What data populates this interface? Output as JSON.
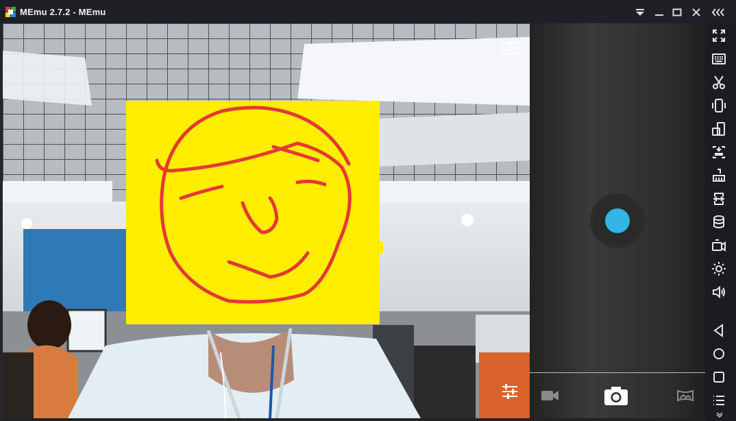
{
  "window": {
    "title": "MEmu 2.7.2 - MEmu",
    "controls": [
      "dropdown-icon",
      "minimize-icon",
      "maximize-icon",
      "close-icon",
      "collapse-sidebar-icon"
    ]
  },
  "camera": {
    "preview_scene": "office",
    "overlay_icons": [
      "switch-camera-icon",
      "settings-sliders-icon"
    ],
    "shutter_color": "#33b5e5",
    "modes": [
      "video-mode-icon",
      "photo-mode-icon",
      "panorama-mode-icon"
    ],
    "active_mode": "photo-mode-icon"
  },
  "sidebar": {
    "tools": [
      "fullscreen-icon",
      "keyboard-mapping-icon",
      "screenshot-scissors-icon",
      "shake-icon",
      "rotate-icon",
      "install-apk-icon",
      "clean-broom-icon",
      "file-transfer-icon",
      "data-storage-icon",
      "record-video-icon",
      "settings-gear-icon",
      "volume-icon"
    ],
    "navigation": [
      "back-icon",
      "home-icon",
      "recent-apps-icon",
      "menu-icon"
    ]
  },
  "colors": {
    "titlebar_bg": "#1e2026",
    "sidebar_bg": "#1b1c20",
    "accent": "#33b5e5",
    "mask_yellow": "#ffee00",
    "mask_drawing": "#e53935"
  }
}
